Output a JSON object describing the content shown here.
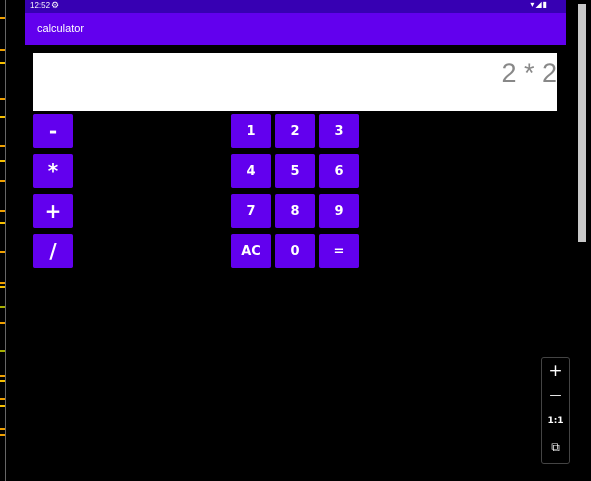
{
  "status_bar": {
    "time": "12:52",
    "gear_icon": "gear-icon",
    "right_icons": "▾◢▮"
  },
  "app_bar": {
    "title": "calculator"
  },
  "display": {
    "expression": "2 * 2"
  },
  "operators": [
    "-",
    "*",
    "+",
    "/"
  ],
  "keypad": [
    [
      "1",
      "2",
      "3"
    ],
    [
      "4",
      "5",
      "6"
    ],
    [
      "7",
      "8",
      "9"
    ],
    [
      "AC",
      "0",
      "="
    ]
  ],
  "zoom_controls": {
    "zoom_in": "+",
    "zoom_out": "—",
    "actual_size": "1:1",
    "fit": "⧉"
  },
  "colors": {
    "primary": "#6200ee",
    "status_bar": "#3700b3",
    "background": "#000000"
  }
}
